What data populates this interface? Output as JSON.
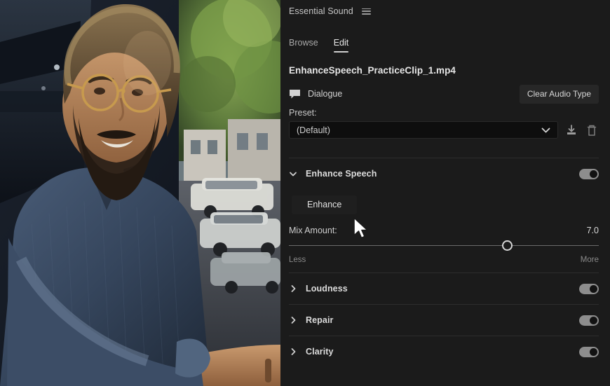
{
  "panel": {
    "title": "Essential Sound",
    "menu_icon": "hamburger-menu-icon",
    "tabs": [
      {
        "label": "Browse",
        "active": false
      },
      {
        "label": "Edit",
        "active": true
      }
    ],
    "clip_name": "EnhanceSpeech_PracticeClip_1.mp4",
    "audio_type": {
      "icon": "speech-bubble-icon",
      "label": "Dialogue",
      "clear_button": "Clear Audio Type"
    },
    "preset": {
      "label": "Preset:",
      "value": "(Default)",
      "placeholder": "(Default)",
      "dropdown_icon": "chevron-down-icon",
      "save_icon": "save-preset-icon",
      "delete_icon": "trash-icon"
    },
    "sections": [
      {
        "name": "enhance-speech",
        "title": "Enhance Speech",
        "expanded": true,
        "toggle_on": true,
        "twisty_icon": "chevron-down-icon",
        "enhance_button": "Enhance",
        "mix": {
          "label": "Mix Amount:",
          "value": "7.0",
          "percent": 70.5,
          "min_label": "Less",
          "max_label": "More"
        }
      },
      {
        "name": "loudness",
        "title": "Loudness",
        "expanded": false,
        "toggle_on": true,
        "twisty_icon": "chevron-right-icon"
      },
      {
        "name": "repair",
        "title": "Repair",
        "expanded": false,
        "toggle_on": true,
        "twisty_icon": "chevron-right-icon"
      },
      {
        "name": "clarity",
        "title": "Clarity",
        "expanded": false,
        "toggle_on": true,
        "twisty_icon": "chevron-right-icon"
      }
    ]
  },
  "preview": {
    "description": "Video still: bearded man with glasses in blue shirt leaning on a railing on a city street",
    "cursor_icon": "mouse-pointer-arrow"
  },
  "colors": {
    "panel_background": "#1b1b1b",
    "field_background": "#0e0e0e",
    "button_background": "#272727",
    "toggle_on": "#8d8d8d",
    "text_primary": "#e6e6e6",
    "text_secondary": "#a9a9a9",
    "divider": "#2d2d2d"
  }
}
